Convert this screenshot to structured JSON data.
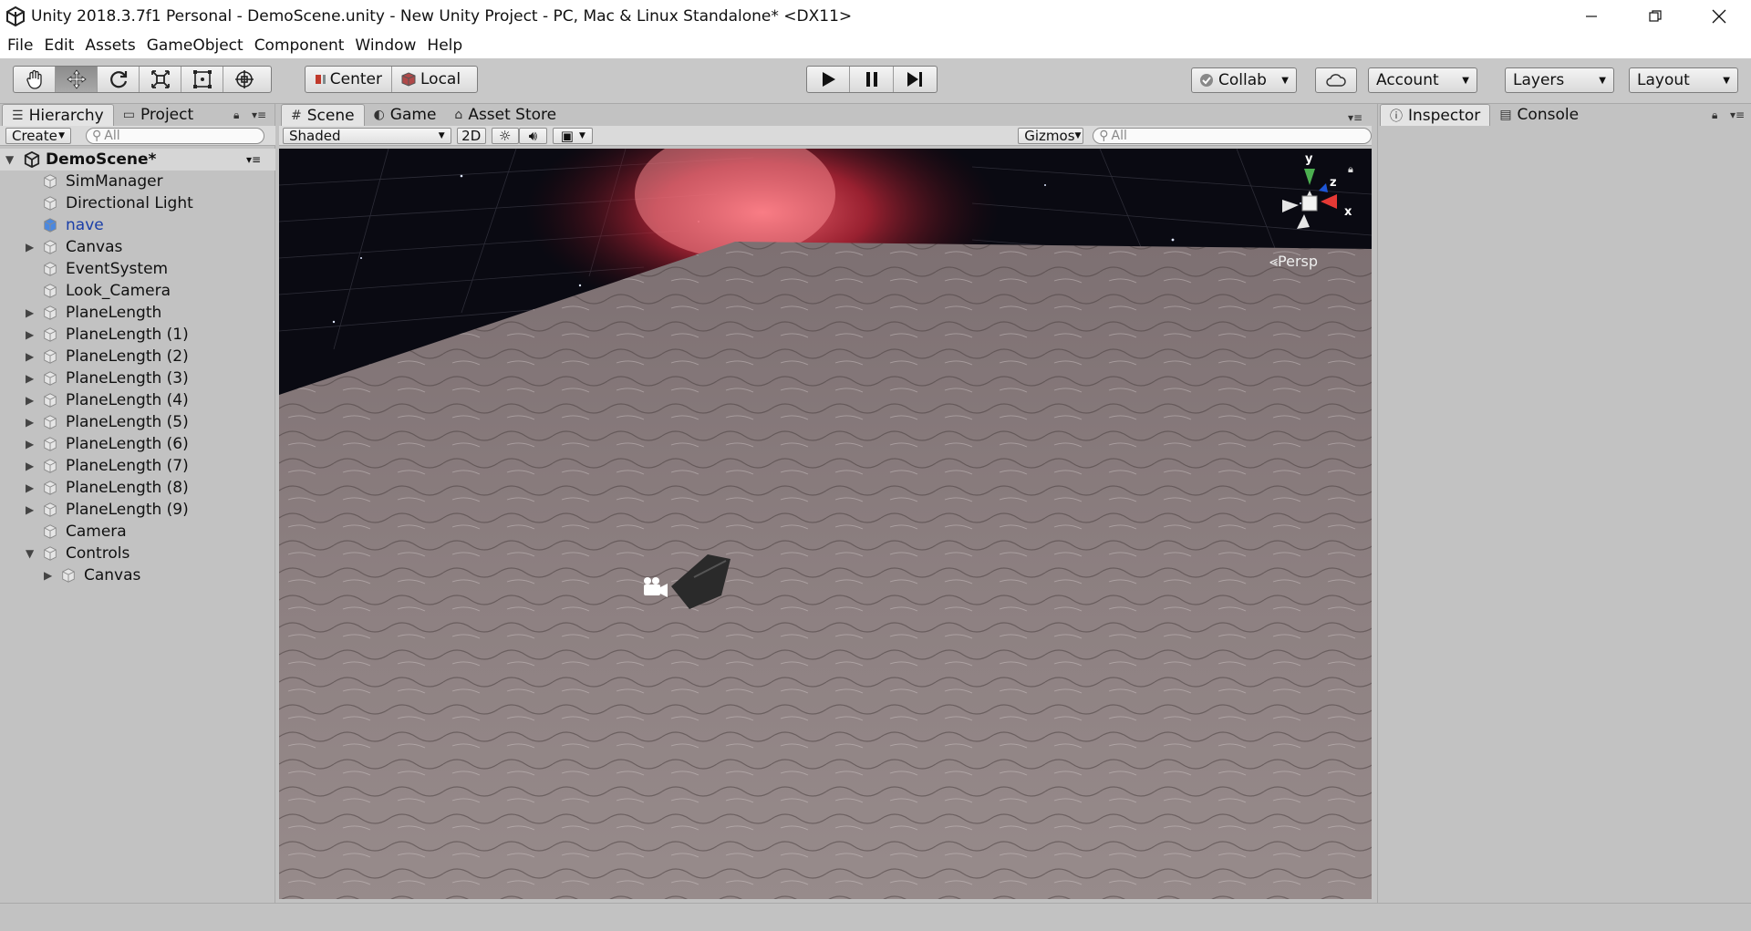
{
  "window": {
    "title": "Unity 2018.3.7f1 Personal - DemoScene.unity - New Unity Project - PC, Mac & Linux Standalone* <DX11>"
  },
  "menu": [
    "File",
    "Edit",
    "Assets",
    "GameObject",
    "Component",
    "Window",
    "Help"
  ],
  "toolbar": {
    "tools": [
      "hand-tool",
      "move-tool",
      "rotate-tool",
      "scale-tool",
      "rect-tool",
      "transform-tool"
    ],
    "active_tool": "move-tool",
    "pivot_mode": "Center",
    "pivot_rotation": "Local",
    "collab": "Collab",
    "account": "Account",
    "layers": "Layers",
    "layout": "Layout"
  },
  "hierarchy": {
    "tabs": {
      "hierarchy": "Hierarchy",
      "project": "Project"
    },
    "create": "Create",
    "search_placeholder": "All",
    "scene_name": "DemoScene*",
    "items": [
      {
        "label": "SimManager",
        "depth": 1,
        "expandable": false,
        "expanded": false,
        "selected": false
      },
      {
        "label": "Directional Light",
        "depth": 1,
        "expandable": false,
        "expanded": false,
        "selected": false
      },
      {
        "label": "nave",
        "depth": 1,
        "expandable": false,
        "expanded": false,
        "selected": true
      },
      {
        "label": "Canvas",
        "depth": 1,
        "expandable": true,
        "expanded": false,
        "selected": false
      },
      {
        "label": "EventSystem",
        "depth": 1,
        "expandable": false,
        "expanded": false,
        "selected": false
      },
      {
        "label": "Look_Camera",
        "depth": 1,
        "expandable": false,
        "expanded": false,
        "selected": false
      },
      {
        "label": "PlaneLength",
        "depth": 1,
        "expandable": true,
        "expanded": false,
        "selected": false
      },
      {
        "label": "PlaneLength (1)",
        "depth": 1,
        "expandable": true,
        "expanded": false,
        "selected": false
      },
      {
        "label": "PlaneLength (2)",
        "depth": 1,
        "expandable": true,
        "expanded": false,
        "selected": false
      },
      {
        "label": "PlaneLength (3)",
        "depth": 1,
        "expandable": true,
        "expanded": false,
        "selected": false
      },
      {
        "label": "PlaneLength (4)",
        "depth": 1,
        "expandable": true,
        "expanded": false,
        "selected": false
      },
      {
        "label": "PlaneLength (5)",
        "depth": 1,
        "expandable": true,
        "expanded": false,
        "selected": false
      },
      {
        "label": "PlaneLength (6)",
        "depth": 1,
        "expandable": true,
        "expanded": false,
        "selected": false
      },
      {
        "label": "PlaneLength (7)",
        "depth": 1,
        "expandable": true,
        "expanded": false,
        "selected": false
      },
      {
        "label": "PlaneLength (8)",
        "depth": 1,
        "expandable": true,
        "expanded": false,
        "selected": false
      },
      {
        "label": "PlaneLength (9)",
        "depth": 1,
        "expandable": true,
        "expanded": false,
        "selected": false
      },
      {
        "label": "Camera",
        "depth": 1,
        "expandable": false,
        "expanded": false,
        "selected": false
      },
      {
        "label": "Controls",
        "depth": 1,
        "expandable": true,
        "expanded": true,
        "selected": false
      },
      {
        "label": "Canvas",
        "depth": 2,
        "expandable": true,
        "expanded": false,
        "selected": false
      }
    ]
  },
  "scene": {
    "tabs": {
      "scene": "Scene",
      "game": "Game",
      "asset_store": "Asset Store"
    },
    "shading": "Shaded",
    "mode_2d": "2D",
    "gizmos": "Gizmos",
    "search_placeholder": "All",
    "projection": "Persp",
    "axes": {
      "y": "y",
      "z": "z",
      "x": "x"
    }
  },
  "inspector": {
    "tabs": {
      "inspector": "Inspector",
      "console": "Console"
    }
  },
  "colors": {
    "selected_text": "#1a3ea8",
    "panel_bg": "#c2c2c2",
    "ground": "#8c7f80",
    "nebula": "#d8384a"
  }
}
